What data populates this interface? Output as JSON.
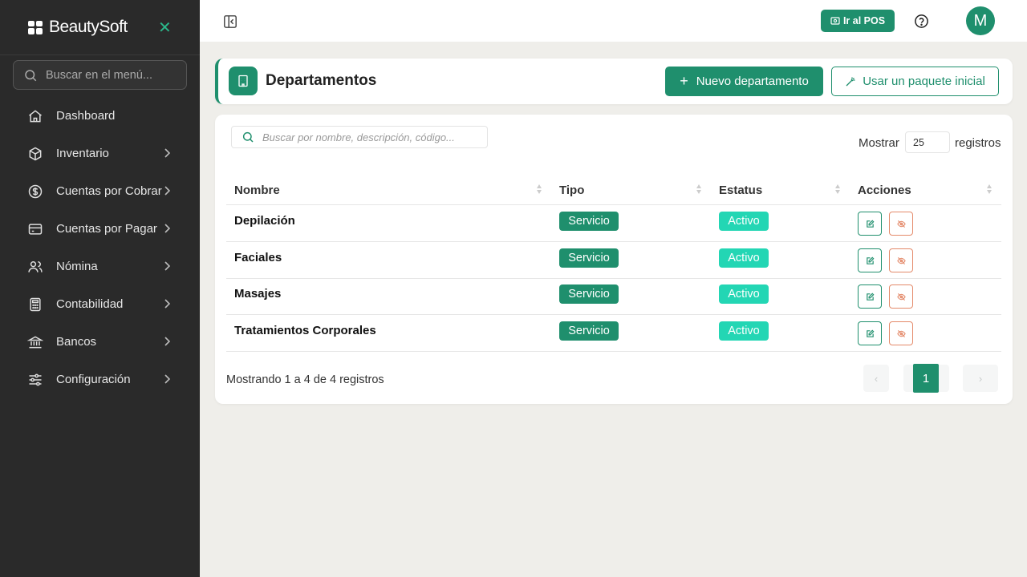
{
  "app": {
    "brand": "BeautySoft"
  },
  "sidebar": {
    "search_placeholder": "Buscar en el menú...",
    "items": [
      {
        "label": "Dashboard",
        "icon": "home-icon",
        "has_children": false
      },
      {
        "label": "Inventario",
        "icon": "box-icon",
        "has_children": true
      },
      {
        "label": "Cuentas por Cobrar",
        "icon": "dollar-circle-icon",
        "has_children": true
      },
      {
        "label": "Cuentas por Pagar",
        "icon": "credit-card-icon",
        "has_children": true
      },
      {
        "label": "Nómina",
        "icon": "users-icon",
        "has_children": true
      },
      {
        "label": "Contabilidad",
        "icon": "calculator-icon",
        "has_children": true
      },
      {
        "label": "Bancos",
        "icon": "bank-icon",
        "has_children": true
      },
      {
        "label": "Configuración",
        "icon": "sliders-icon",
        "has_children": true
      }
    ]
  },
  "topbar": {
    "pos_label": "Ir al POS",
    "avatar_initial": "M"
  },
  "header": {
    "title": "Departamentos",
    "new_button": "Nuevo departamento",
    "package_button": "Usar un paquete inicial"
  },
  "table": {
    "search_placeholder": "Buscar por nombre, descripción, código...",
    "show_label": "Mostrar",
    "show_value": "25",
    "show_suffix": "registros",
    "columns": [
      "Nombre",
      "Tipo",
      "Estatus",
      "Acciones"
    ],
    "rows": [
      {
        "name": "Depilación",
        "type": "Servicio",
        "status": "Activo"
      },
      {
        "name": "Faciales",
        "type": "Servicio",
        "status": "Activo"
      },
      {
        "name": "Masajes",
        "type": "Servicio",
        "status": "Activo"
      },
      {
        "name": "Tratamientos Corporales",
        "type": "Servicio",
        "status": "Activo"
      }
    ],
    "footer_info": "Mostrando 1 a 4 de 4 registros",
    "pagination": {
      "prev": "‹",
      "current": "1",
      "next": "›"
    }
  },
  "colors": {
    "accent": "#1f8f6d",
    "status_active": "#23d6b4",
    "danger_outline": "#e48a6a",
    "sidebar_bg": "#2a2a2a",
    "page_bg": "#efeeea"
  }
}
